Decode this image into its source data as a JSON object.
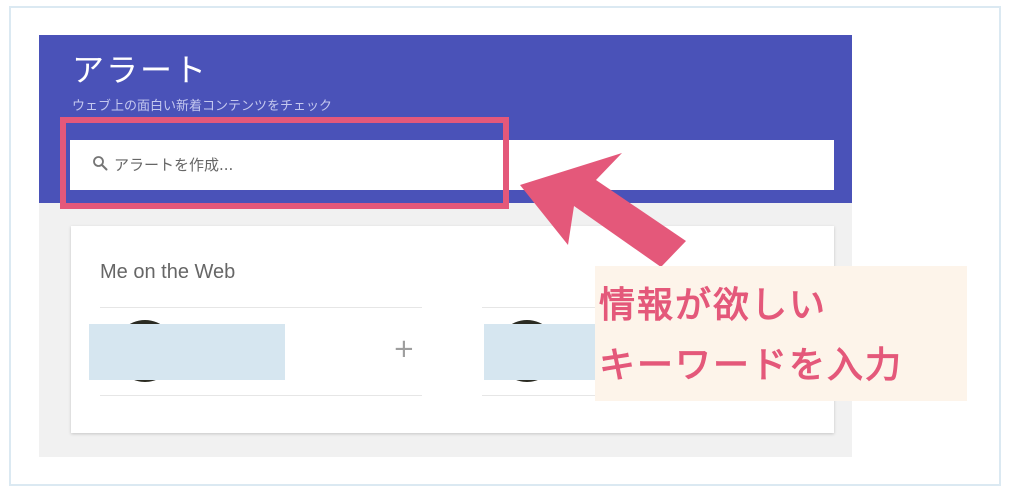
{
  "header": {
    "title": "アラート",
    "subtitle": "ウェブ上の面白い新着コンテンツをチェック"
  },
  "search": {
    "placeholder": "アラートを作成..."
  },
  "card": {
    "title": "Me on the Web",
    "add_symbol": "+"
  },
  "annotation": {
    "line1": "情報が欲しい",
    "line2": "キーワードを入力"
  },
  "colors": {
    "header_bg": "#4a52b8",
    "highlight": "#e4587a",
    "callout_bg": "#fdf4ea"
  },
  "icons": {
    "search": "search-icon",
    "arrow": "arrow-icon",
    "add": "plus-icon"
  }
}
